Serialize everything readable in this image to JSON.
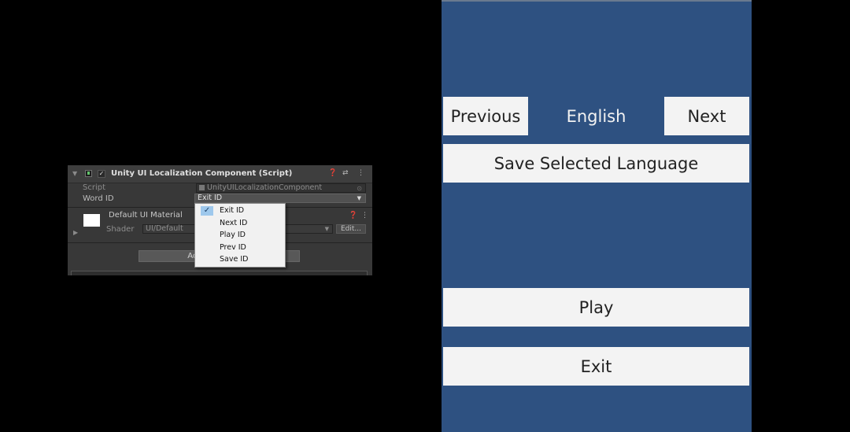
{
  "inspector": {
    "component_title": "Unity UI Localization Component (Script)",
    "script_label": "Script",
    "script_value": "UnityUILocalizationComponent",
    "word_id_label": "Word ID",
    "word_id_value": "Exit ID",
    "material_title": "Default UI Material",
    "shader_label": "Shader",
    "shader_value": "UI/Default",
    "edit_label": "Edit...",
    "add_label": "Add Component"
  },
  "dropdown": {
    "items": [
      {
        "label": "Exit ID",
        "selected": true
      },
      {
        "label": "Next ID",
        "selected": false
      },
      {
        "label": "Play ID",
        "selected": false
      },
      {
        "label": "Prev ID",
        "selected": false
      },
      {
        "label": "Save ID",
        "selected": false
      }
    ]
  },
  "game": {
    "previous_label": "Previous",
    "language_label": "English",
    "next_label": "Next",
    "save_label": "Save Selected Language",
    "play_label": "Play",
    "exit_label": "Exit",
    "background_color": "#2e5181",
    "button_color": "#f3f3f3"
  }
}
